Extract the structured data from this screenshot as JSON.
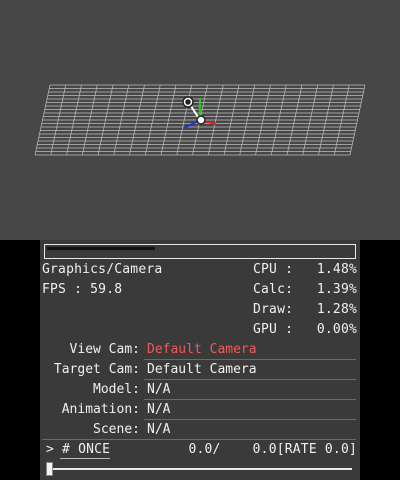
{
  "colors": {
    "viewport_bg": "#474747",
    "panel_bg": "#3a3a3a",
    "highlight": "#f05a5a"
  },
  "header": {
    "title": "Graphics/Camera",
    "fps_label": "FPS : 59.8"
  },
  "perf": {
    "cpu_label": "CPU :",
    "cpu_value": "1.48%",
    "calc_label": "Calc:",
    "calc_value": "1.39%",
    "draw_label": "Draw:",
    "draw_value": "1.28%",
    "gpu_label": "GPU :",
    "gpu_value": "0.00%"
  },
  "rows": {
    "view_cam_label": "View Cam:",
    "view_cam_value": "Default Camera",
    "target_cam_label": "Target Cam:",
    "target_cam_value": "Default Camera",
    "model_label": "Model:",
    "model_value": "N/A",
    "animation_label": "Animation:",
    "animation_value": "N/A",
    "scene_label": "Scene:",
    "scene_value": "N/A"
  },
  "playback": {
    "mode_label": "> # ONCE",
    "frame_text": "0.0/    0.0[RATE 0.0]",
    "slider_position": 0.0
  },
  "icons": {
    "camera": "camera-icon",
    "axis_gizmo": "axis-gizmo-icon"
  }
}
